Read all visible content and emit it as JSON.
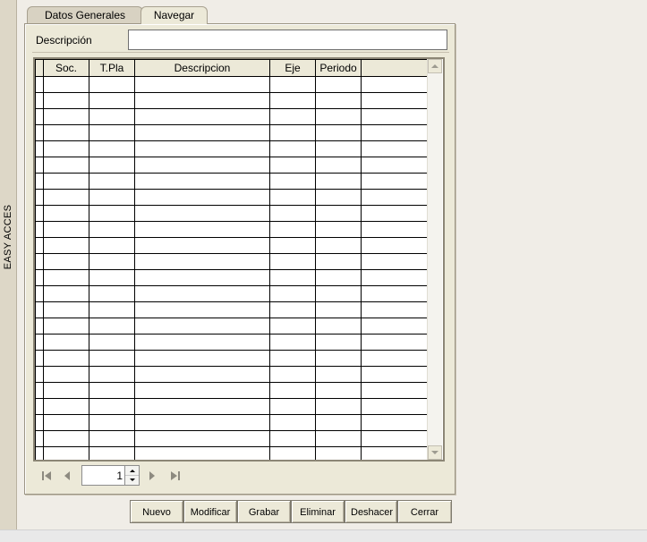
{
  "sidebar": {
    "label": "EASY ACCES"
  },
  "tabs": [
    {
      "label": "Datos Generales",
      "active": false
    },
    {
      "label": "Navegar",
      "active": true
    }
  ],
  "filter": {
    "label": "Descripción",
    "value": ""
  },
  "grid": {
    "columns": [
      "",
      "Soc.",
      "T.Pla",
      "Descripcion",
      "Eje",
      "Periodo",
      ""
    ],
    "empty_row_count": 24
  },
  "navigator": {
    "page": "1",
    "icons": [
      "first-record-icon",
      "prev-record-icon",
      "next-record-icon",
      "last-record-icon"
    ]
  },
  "actions": {
    "nuevo": "Nuevo",
    "modificar": "Modificar",
    "grabar": "Grabar",
    "eliminar": "Eliminar",
    "deshacer": "Deshacer",
    "cerrar": "Cerrar"
  },
  "colors": {
    "panel": "#ece9d8",
    "sidebar": "#ddd7c7",
    "background": "#f0ede7",
    "grid_line": "#000000"
  }
}
